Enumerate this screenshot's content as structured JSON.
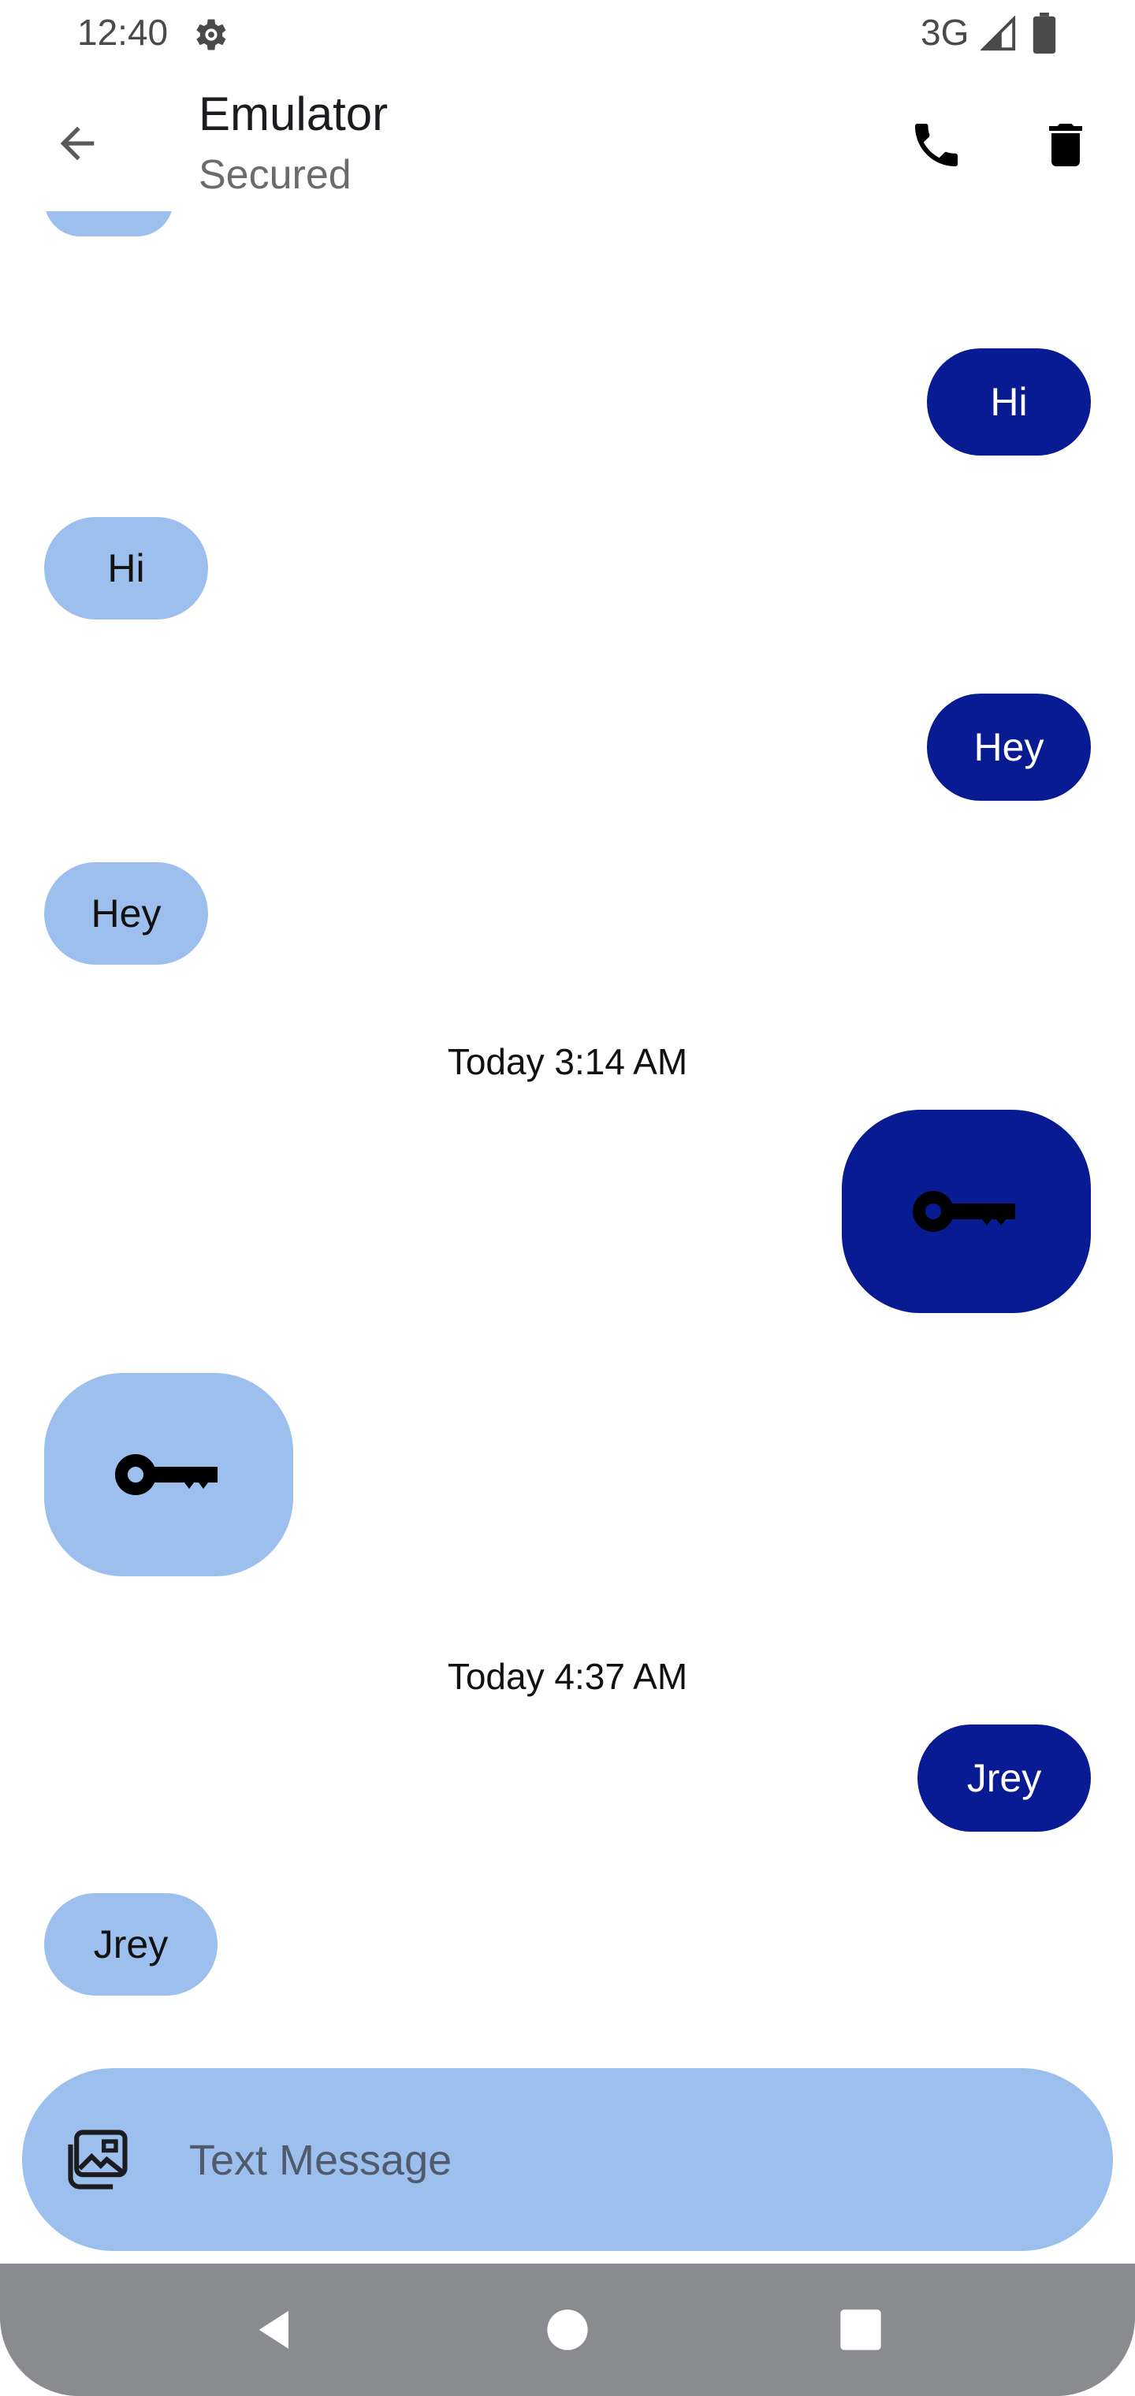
{
  "status_bar": {
    "time": "12:40",
    "network": "3G",
    "icons": [
      "gear-icon",
      "signal-icon",
      "battery-icon"
    ]
  },
  "header": {
    "title": "Emulator",
    "subtitle": "Secured",
    "actions": [
      "back-arrow-icon",
      "phone-icon",
      "trash-icon"
    ]
  },
  "messages": [
    {
      "from": "received",
      "text": ""
    },
    {
      "from": "sent",
      "text": "Hi"
    },
    {
      "from": "received",
      "text": "Hi"
    },
    {
      "from": "sent",
      "text": "Hey"
    },
    {
      "from": "received",
      "text": "Hey"
    },
    {
      "timestamp": "Today 3:14 AM"
    },
    {
      "from": "sent",
      "icon": "key-icon"
    },
    {
      "from": "received",
      "icon": "key-icon"
    },
    {
      "timestamp": "Today 4:37 AM"
    },
    {
      "from": "sent",
      "text": "Jrey"
    },
    {
      "from": "received",
      "text": "Jrey"
    }
  ],
  "timestamps": [
    "Today 3:14 AM",
    "Today 4:37 AM"
  ],
  "composer": {
    "placeholder": "Text Message",
    "value": "",
    "attach_icon": "gallery-icon"
  },
  "nav_bar": [
    "nav-back-icon",
    "nav-home-icon",
    "nav-recents-icon"
  ],
  "colors": {
    "sent_bubble": "#081b93",
    "received_bubble": "#9dbfee",
    "nav_bar": "#898b8e"
  }
}
